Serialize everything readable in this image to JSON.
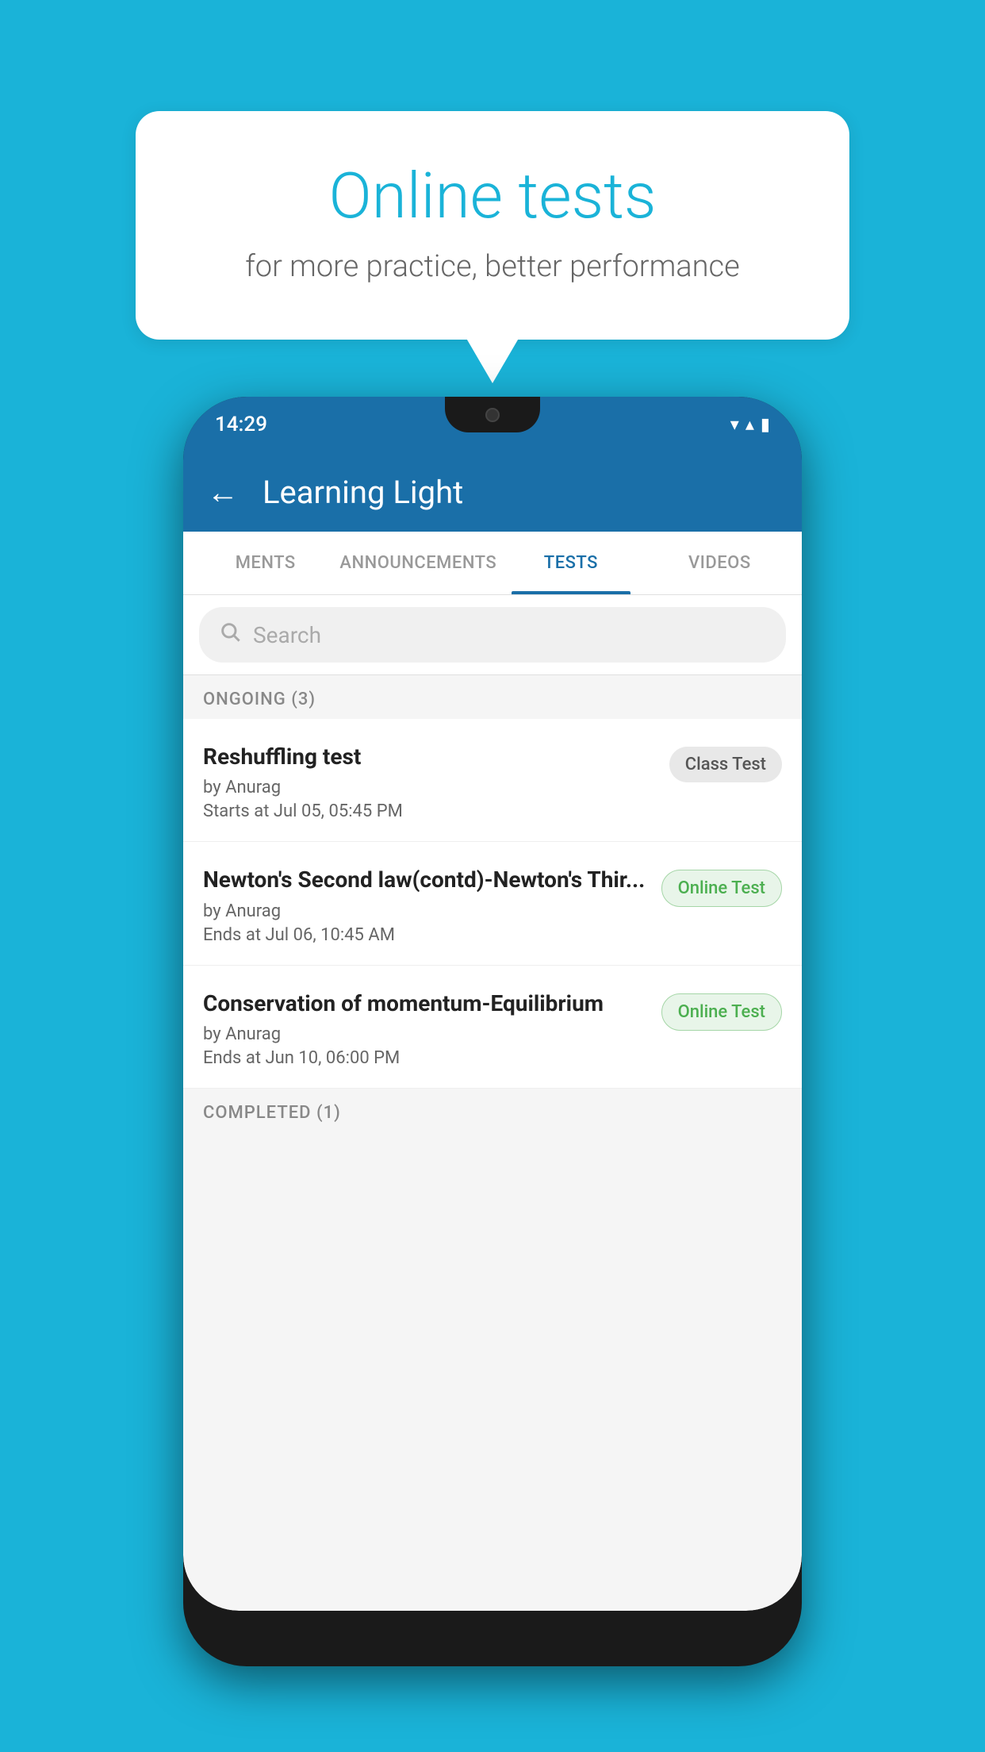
{
  "background": {
    "color": "#1ab3d8"
  },
  "speech_bubble": {
    "title": "Online tests",
    "subtitle": "for more practice, better performance"
  },
  "phone": {
    "status_bar": {
      "time": "14:29",
      "wifi_icon": "▼",
      "signal_icon": "▲",
      "battery_icon": "▮"
    },
    "app_bar": {
      "back_label": "←",
      "title": "Learning Light"
    },
    "tabs": [
      {
        "label": "MENTS",
        "active": false
      },
      {
        "label": "ANNOUNCEMENTS",
        "active": false
      },
      {
        "label": "TESTS",
        "active": true
      },
      {
        "label": "VIDEOS",
        "active": false
      }
    ],
    "search": {
      "placeholder": "Search"
    },
    "section_ongoing": {
      "title": "ONGOING (3)"
    },
    "tests": [
      {
        "name": "Reshuffling test",
        "author": "by Anurag",
        "time_label": "Starts at",
        "time": "Jul 05, 05:45 PM",
        "badge": "Class Test",
        "badge_type": "class"
      },
      {
        "name": "Newton's Second law(contd)-Newton's Thir...",
        "author": "by Anurag",
        "time_label": "Ends at",
        "time": "Jul 06, 10:45 AM",
        "badge": "Online Test",
        "badge_type": "online"
      },
      {
        "name": "Conservation of momentum-Equilibrium",
        "author": "by Anurag",
        "time_label": "Ends at",
        "time": "Jun 10, 06:00 PM",
        "badge": "Online Test",
        "badge_type": "online"
      }
    ],
    "section_completed": {
      "title": "COMPLETED (1)"
    }
  }
}
